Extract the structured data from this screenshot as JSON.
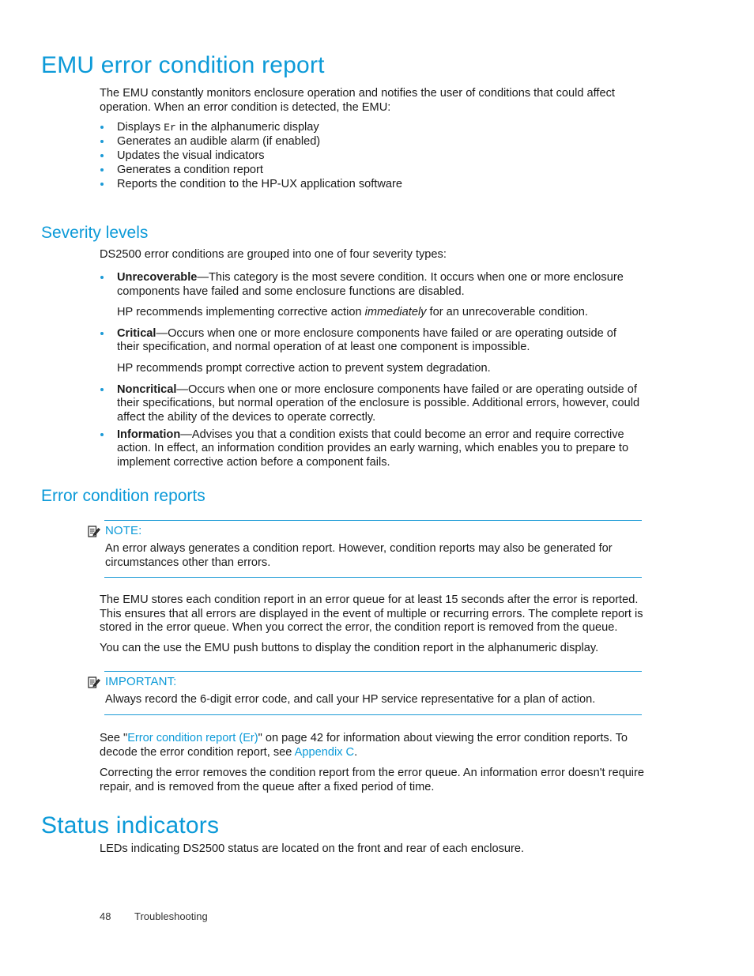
{
  "colors": {
    "heading_blue": "#0c9ad8",
    "bullet_blue": "#1b9ad6",
    "rule_blue": "#1b9ad6",
    "body_text": "#1a1a1a"
  },
  "title": "EMU error condition report",
  "intro": {
    "paragraph": "The EMU constantly monitors enclosure operation and notifies the user of conditions that could affect operation.  When an error condition is detected, the EMU:",
    "bullets": [
      {
        "pre": "Displays ",
        "code": "Er",
        "post": " in the alphanumeric display"
      },
      {
        "pre": "Generates an audible alarm (if enabled)",
        "code": "",
        "post": ""
      },
      {
        "pre": "Updates the visual indicators",
        "code": "",
        "post": ""
      },
      {
        "pre": "Generates a condition report",
        "code": "",
        "post": ""
      },
      {
        "pre": "Reports the condition to the HP-UX application software",
        "code": "",
        "post": ""
      }
    ]
  },
  "severity": {
    "heading": "Severity levels",
    "lead": "DS2500 error conditions are grouped into one of four severity types:",
    "items": [
      {
        "term": "Unrecoverable",
        "dash": "—",
        "text": "This category is the most severe condition.  It occurs when one or more enclosure components have failed and some enclosure functions are disabled.",
        "follow_pre": "HP recommends implementing corrective action ",
        "follow_italic": "immediately",
        "follow_post": " for an unrecoverable condition."
      },
      {
        "term": "Critical",
        "dash": "—",
        "text": "Occurs when one or more enclosure components have failed or are operating outside of their specification, and normal operation of at least one component is impossible.",
        "follow_pre": "HP recommends prompt corrective action to prevent system degradation.",
        "follow_italic": "",
        "follow_post": ""
      },
      {
        "term": "Noncritical",
        "dash": "—",
        "text": "Occurs when one or more enclosure components have failed or are operating outside of their specifications, but normal operation of the enclosure is possible.  Additional errors, however, could affect the ability of the devices to operate correctly.",
        "follow_pre": "",
        "follow_italic": "",
        "follow_post": ""
      },
      {
        "term": "Information",
        "dash": "—",
        "text": "Advises you that a condition exists that could become an error and require corrective action.  In effect, an information condition provides an early warning, which enables you to prepare to implement corrective action before a component fails.",
        "follow_pre": "",
        "follow_italic": "",
        "follow_post": ""
      }
    ]
  },
  "error_reports": {
    "heading": "Error condition reports",
    "note": {
      "label": "NOTE:",
      "icon": "note-pencil-icon",
      "body": "An error always generates a condition report.  However, condition reports may also be generated for circumstances other than errors."
    },
    "paragraph1": "The EMU stores each condition report in an error queue for at least 15 seconds after the error is reported.  This ensures that all errors are displayed in the event of multiple or recurring errors.  The complete report is stored in the error queue.  When you correct the error, the condition report is removed from the queue.",
    "paragraph2": "You can the use the EMU push buttons to display the condition report in the alphanumeric display.",
    "important": {
      "label": "IMPORTANT:",
      "icon": "important-pencil-icon",
      "body": "Always record the 6-digit error code, and call your HP service representative for a plan of action."
    },
    "see_also": {
      "pre": "See \"",
      "link1": "Error condition report (Er)",
      "mid": "\" on page 42 for information about viewing the error condition reports. To decode the error condition report, see ",
      "link2": "Appendix C",
      "post": "."
    },
    "paragraph3": "Correcting the error removes the condition report from the error queue.  An information error doesn't require repair, and is removed from the queue after a fixed period of time."
  },
  "status_indicators": {
    "heading": "Status indicators",
    "paragraph": "LEDs indicating DS2500 status are located on the front and rear of each enclosure."
  },
  "footer": {
    "page_number": "48",
    "chapter": "Troubleshooting"
  }
}
